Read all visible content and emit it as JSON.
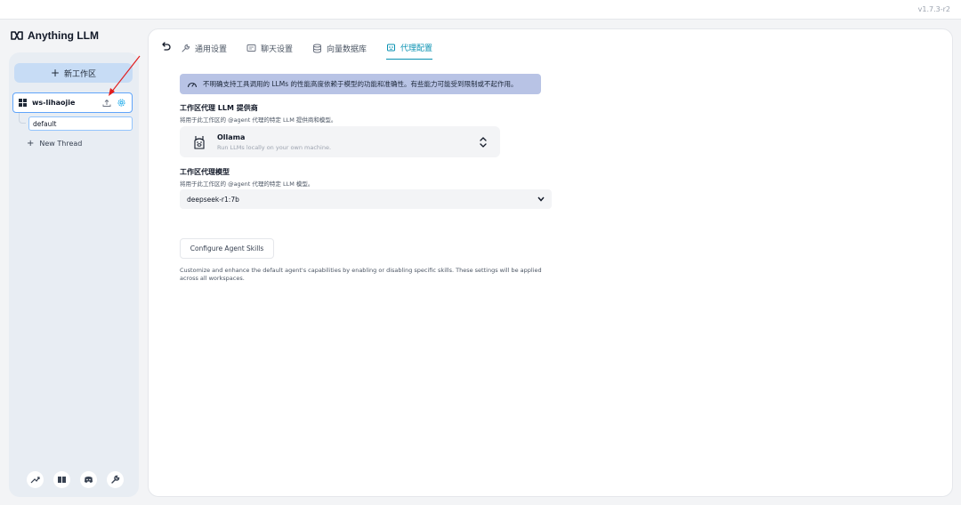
{
  "app": {
    "version": "v1.7.3-r2",
    "logo_text": "Anything LLM"
  },
  "sidebar": {
    "new_workspace_label": "新工作区",
    "workspace": {
      "name": "ws-lihaojie"
    },
    "thread": {
      "name": "default"
    },
    "new_thread_label": "New Thread",
    "footer_icons": [
      "community-hub-icon",
      "docs-book-icon",
      "discord-icon",
      "wrench-settings-icon"
    ]
  },
  "tabs": [
    {
      "label": "通用设置",
      "icon": "wrench-icon",
      "active": false
    },
    {
      "label": "聊天设置",
      "icon": "chat-icon",
      "active": false
    },
    {
      "label": "向量数据库",
      "icon": "database-icon",
      "active": false
    },
    {
      "label": "代理配置",
      "icon": "robot-icon",
      "active": true
    }
  ],
  "warning": {
    "text": "不明确支持工具调用的 LLMs 的性能高度依赖于模型的功能和准确性。有些能力可能受到限制或不起作用。"
  },
  "provider_section": {
    "title": "工作区代理 LLM 提供商",
    "description": "将用于此工作区的 @agent 代理的特定 LLM 提供商和模型。",
    "provider_name": "Ollama",
    "provider_desc": "Run LLMs locally on your own machine."
  },
  "model_section": {
    "title": "工作区代理模型",
    "description": "将用于此工作区的 @agent 代理的特定 LLM 模型。",
    "selected_model": "deepseek-r1:7b"
  },
  "skills": {
    "button_label": "Configure Agent Skills",
    "description": "Customize and enhance the default agent's capabilities by enabling or disabling specific skills. These settings will be applied across all workspaces."
  },
  "colors": {
    "accent": "#0891b2",
    "warning_bg": "#b8c3e5",
    "new_ws_bg": "#c7dcf5",
    "annotation_arrow": "#e11d1d"
  }
}
